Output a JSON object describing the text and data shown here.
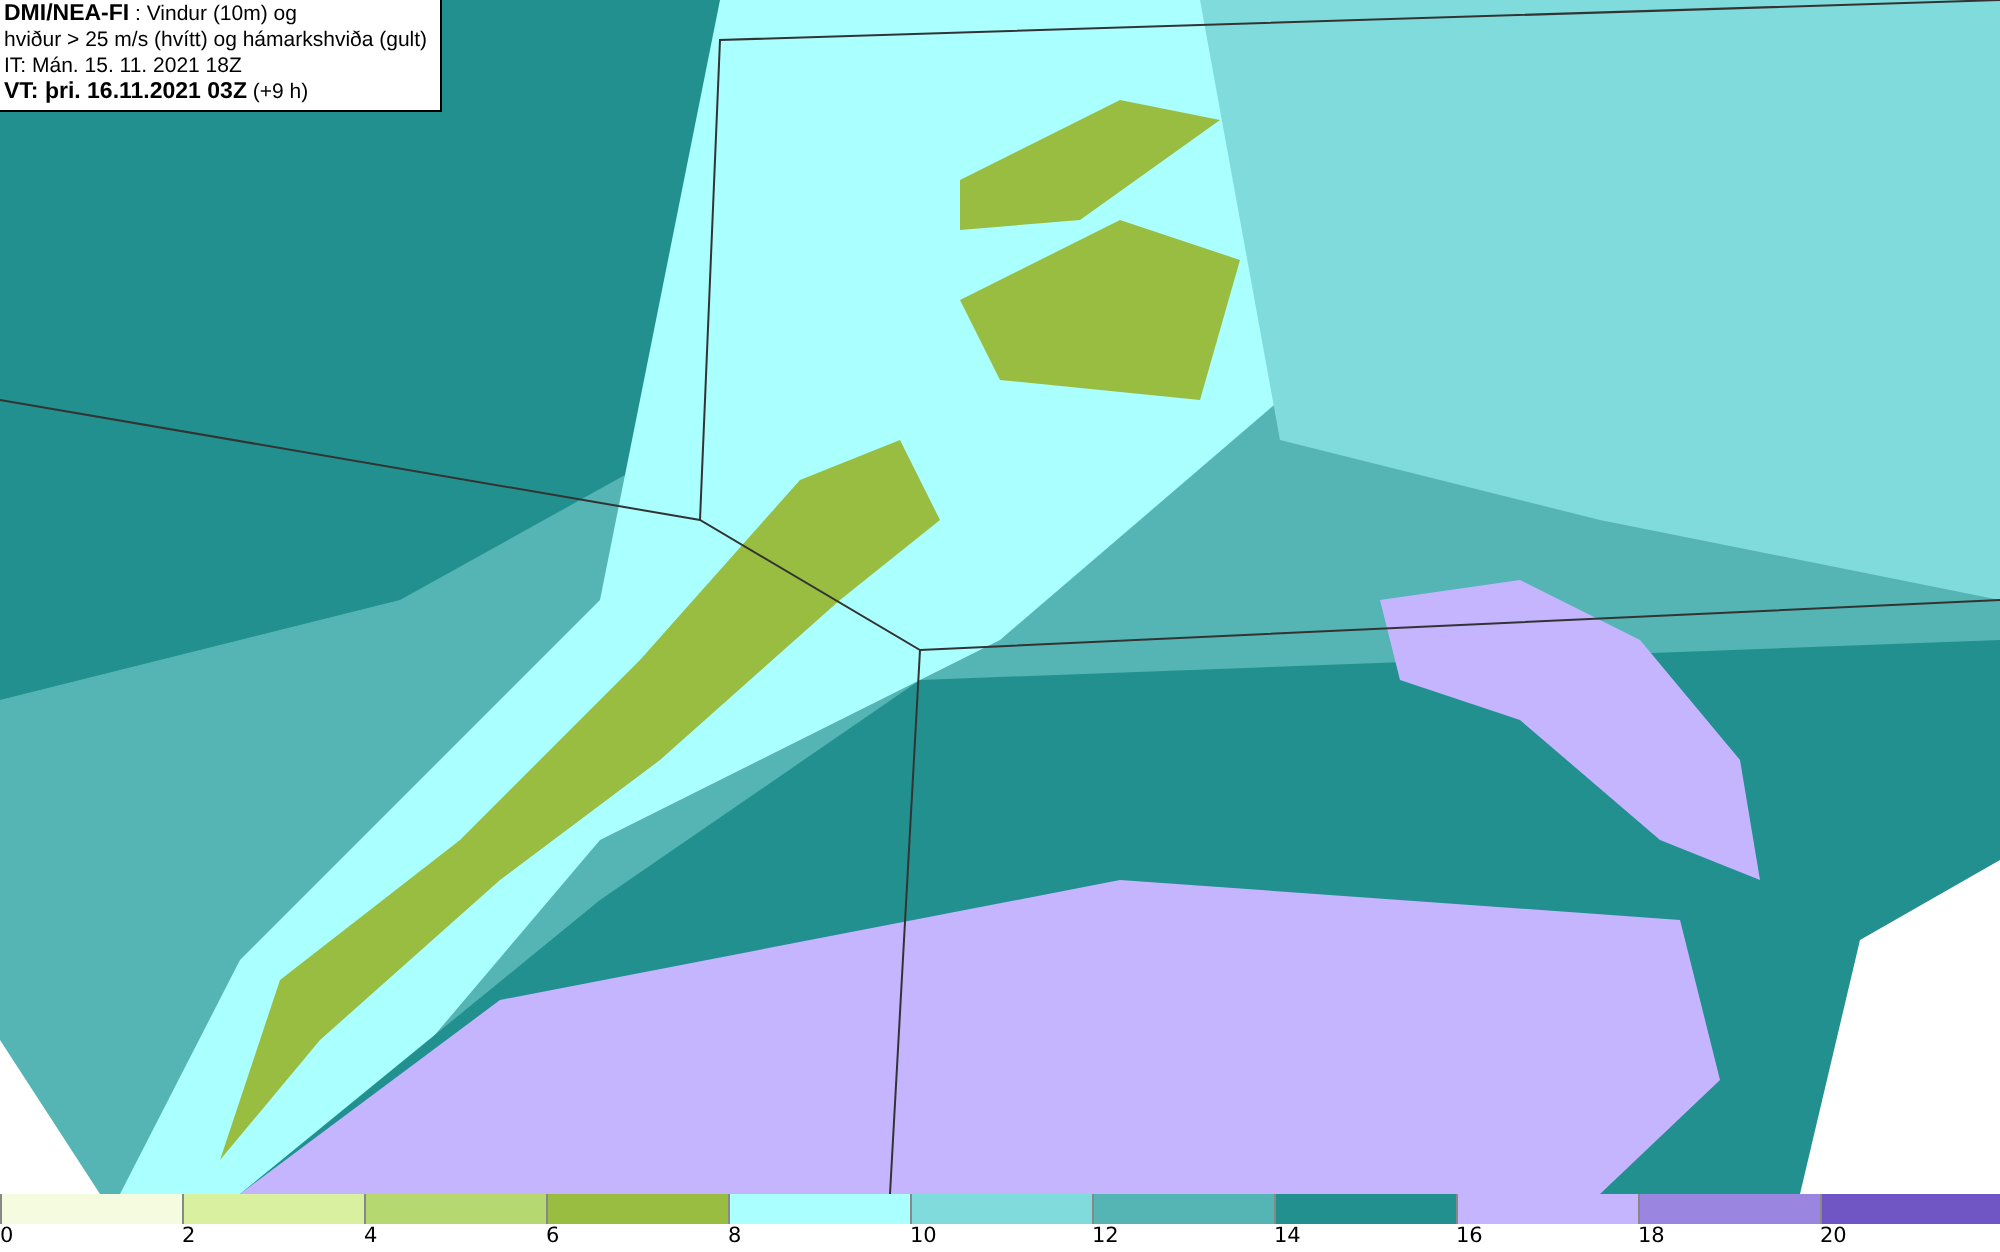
{
  "title_box": {
    "lines": [
      "**DMI/NEA-FI** : Vindur (10m) og",
      "hviður > 25 m/s (hvítt) og hámarkshviða (gult)",
      "IT: Mán. 15. 11. 2021 18Z",
      "**VT: þri. 16.11.2021 03Z** (+9 h)"
    ]
  },
  "legend": {
    "bins": [
      {
        "label": "0",
        "color": "#f5fbdf"
      },
      {
        "label": "2",
        "color": "#d8f0a0"
      },
      {
        "label": "4",
        "color": "#b5d870"
      },
      {
        "label": "6",
        "color": "#98bd40"
      },
      {
        "label": "8",
        "color": "#aaffff"
      },
      {
        "label": "10",
        "color": "#80dcdc"
      },
      {
        "label": "12",
        "color": "#55b5b5"
      },
      {
        "label": "14",
        "color": "#239090"
      },
      {
        "label": "16",
        "color": "#c5b5ff"
      },
      {
        "label": "18",
        "color": "#9a85e0"
      },
      {
        "label": "20",
        "color": "#7055c5"
      }
    ]
  }
}
